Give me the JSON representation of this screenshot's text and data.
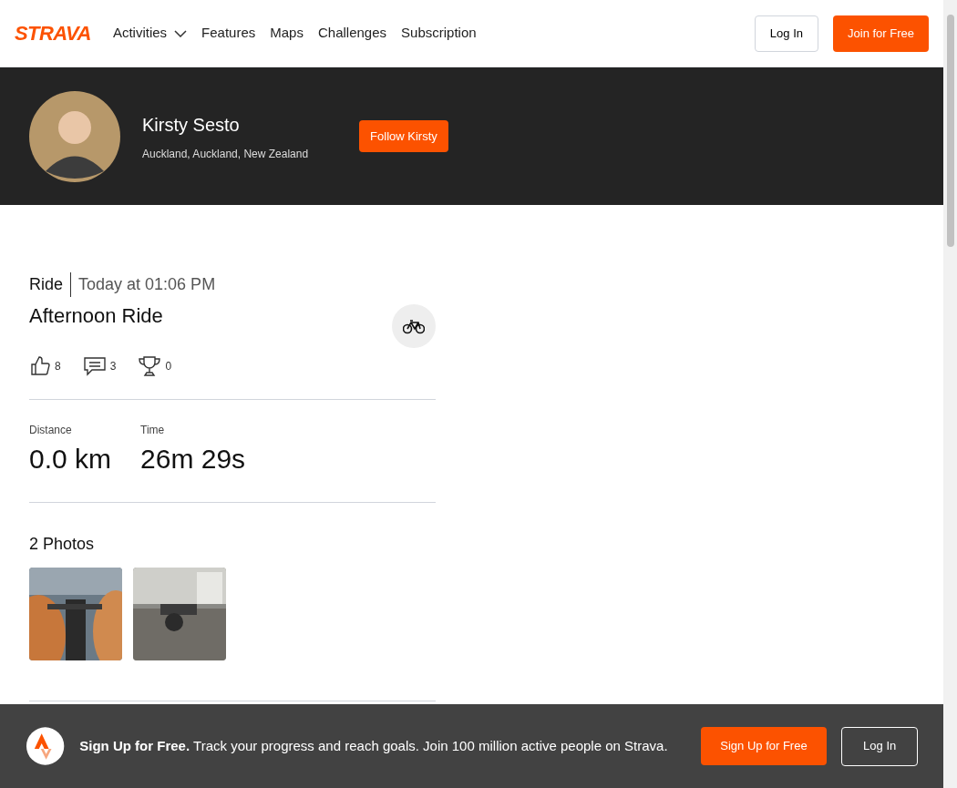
{
  "header": {
    "logo": "STRAVA",
    "nav": [
      {
        "label": "Activities",
        "dropdown": true
      },
      {
        "label": "Features",
        "dropdown": false
      },
      {
        "label": "Maps",
        "dropdown": false
      },
      {
        "label": "Challenges",
        "dropdown": false
      },
      {
        "label": "Subscription",
        "dropdown": false
      }
    ],
    "login": "Log In",
    "join": "Join for Free"
  },
  "athlete": {
    "name": "Kirsty Sesto",
    "location": "Auckland, Auckland, New Zealand",
    "follow": "Follow Kirsty"
  },
  "activity": {
    "type": "Ride",
    "time": "Today at 01:06 PM",
    "title": "Afternoon Ride",
    "kudos": "8",
    "comments": "3",
    "achievements": "0",
    "stats": [
      {
        "label": "Distance",
        "value": "0.0 km"
      },
      {
        "label": "Time",
        "value": "26m 29s"
      }
    ],
    "photos_title": "2 Photos"
  },
  "banner": {
    "lead": "Sign Up for Free.",
    "text": "Track your progress and reach goals. Join 100 million active people on Strava.",
    "signup": "Sign Up for Free",
    "login": "Log In"
  }
}
